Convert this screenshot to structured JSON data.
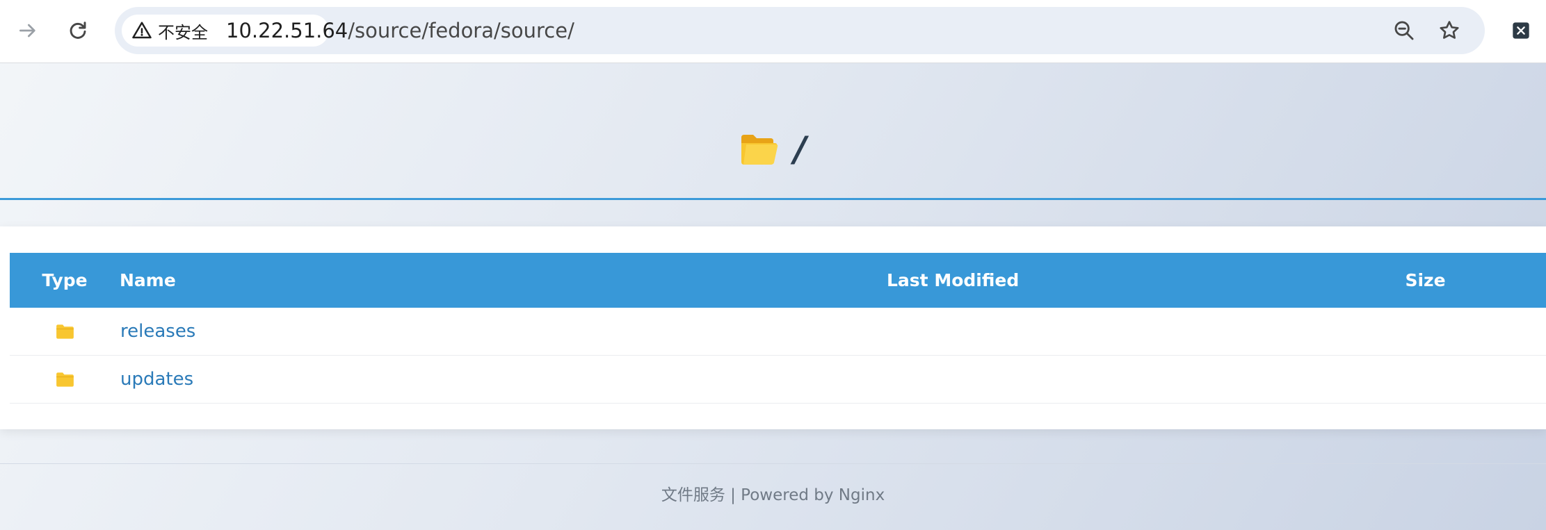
{
  "browser": {
    "security_label": "不安全",
    "url_host": "10.22.51.64",
    "url_path": "/source/fedora/source/"
  },
  "header": {
    "title": "/"
  },
  "table": {
    "columns": [
      "Type",
      "Name",
      "Last Modified",
      "Size"
    ],
    "rows": [
      {
        "type_icon": "folder-icon",
        "name": "releases",
        "last_modified": "",
        "size": ""
      },
      {
        "type_icon": "folder-icon",
        "name": "updates",
        "last_modified": "",
        "size": ""
      }
    ]
  },
  "footer": {
    "text": "文件服务 | Powered by Nginx"
  },
  "colors": {
    "accent": "#3898d8",
    "link": "#2a7ab8",
    "folder": "#f8c630"
  }
}
